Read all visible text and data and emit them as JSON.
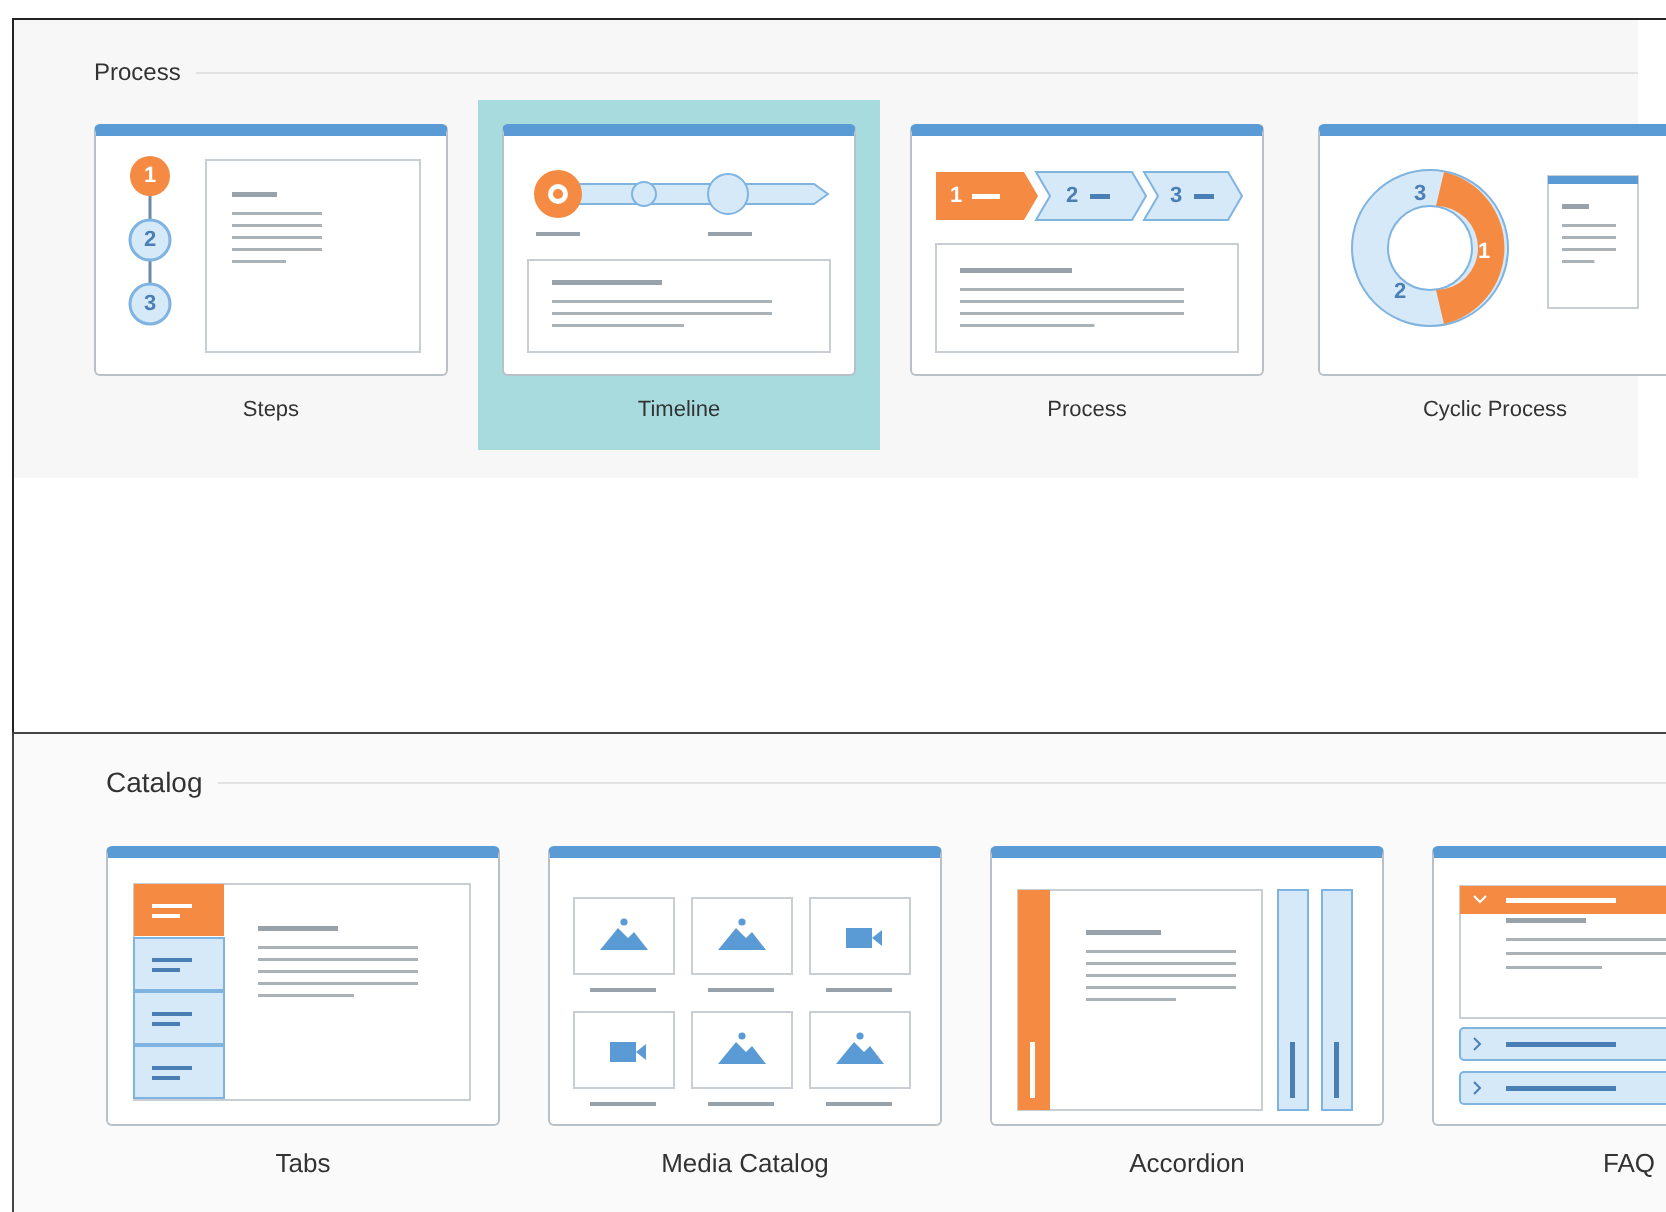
{
  "sections": [
    {
      "title": "Process",
      "kind": "compact",
      "items": [
        {
          "kind": "steps",
          "label": "Steps",
          "selected": false,
          "marks": [
            "1",
            "2",
            "3"
          ]
        },
        {
          "kind": "timeline",
          "label": "Timeline",
          "selected": true
        },
        {
          "kind": "process",
          "label": "Process",
          "selected": false,
          "marks": [
            "1",
            "2",
            "3"
          ]
        },
        {
          "kind": "cycle",
          "label": "Cyclic Process",
          "selected": false,
          "marks": [
            "3",
            "1",
            "2"
          ]
        }
      ]
    },
    {
      "title": "Catalog",
      "kind": "wide",
      "items": [
        {
          "kind": "tabs",
          "label": "Tabs",
          "selected": false
        },
        {
          "kind": "media",
          "label": "Media Catalog",
          "selected": false
        },
        {
          "kind": "accordion",
          "label": "Accordion",
          "selected": false
        },
        {
          "kind": "faq",
          "label": "FAQ",
          "selected": false
        }
      ]
    }
  ]
}
